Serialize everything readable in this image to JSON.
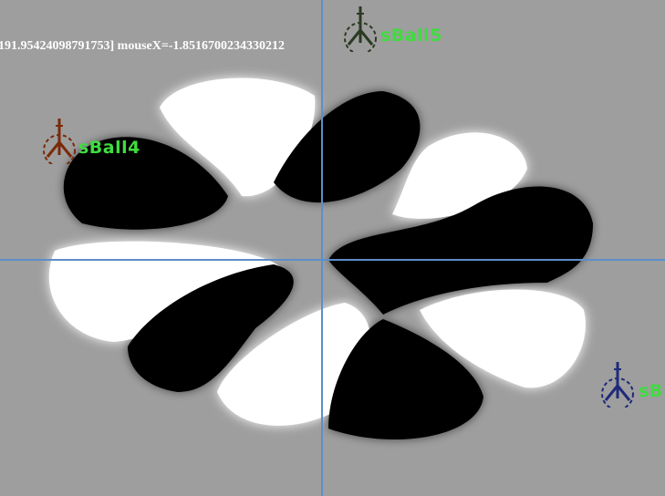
{
  "status": {
    "text": "191.95424098791753] mouseX=-1.8516700234330212"
  },
  "colors": {
    "background": "#9e9e9e",
    "crosshair": "#5b8fc9",
    "label": "#3fdc3f",
    "ball4_marker": "#7a2a08",
    "ball5_marker": "#2b3a22",
    "ball6_marker": "#1f2a7a"
  },
  "balls": [
    {
      "label": "sBall4",
      "icon": "tripod-marker-icon",
      "color": "#7a2a08"
    },
    {
      "label": "sBall5",
      "icon": "tripod-marker-icon",
      "color": "#2b3a22"
    },
    {
      "label": "sB",
      "icon": "tripod-marker-icon",
      "color": "#1f2a7a"
    }
  ]
}
